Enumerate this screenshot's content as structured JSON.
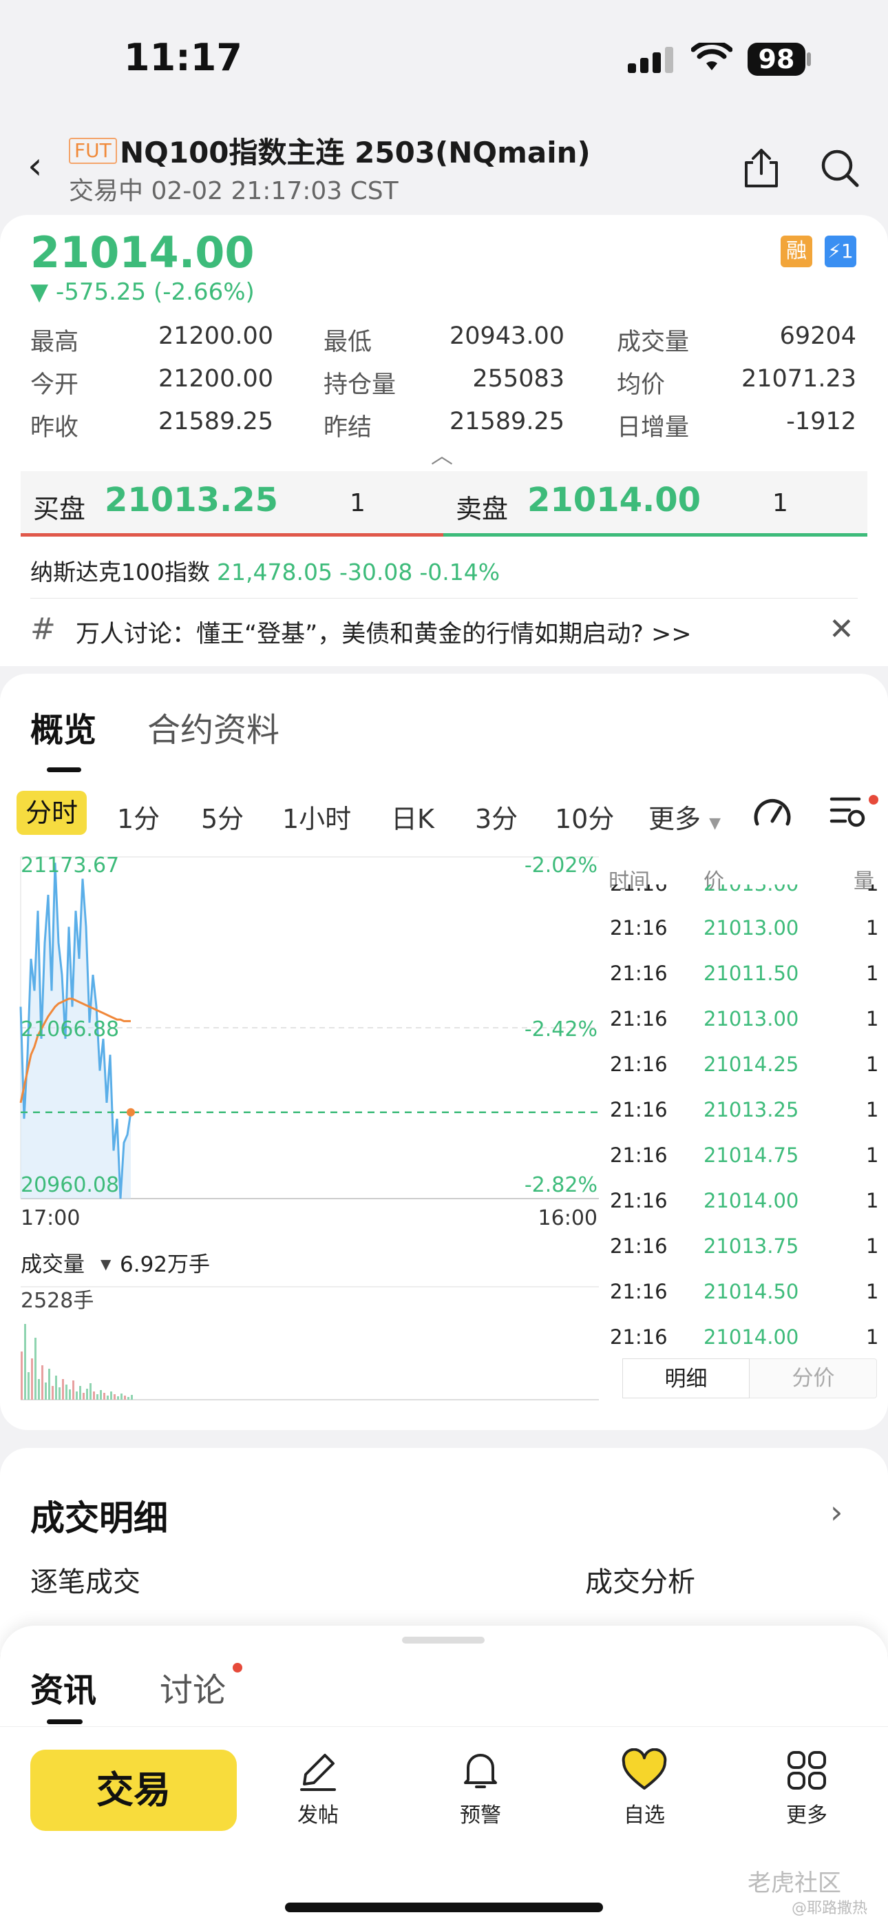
{
  "status_bar": {
    "time": "11:17",
    "battery": "98"
  },
  "header": {
    "badge": "FUT",
    "title": "NQ100指数主连 2503(NQmain)",
    "subtitle": "交易中 02-02 21:17:03 CST"
  },
  "quote": {
    "price": "21014.00",
    "change": "▼ -575.25 (-2.66%)",
    "badge_margin": "融",
    "badge_flash": "⚡1",
    "stats": [
      {
        "label": "最高",
        "value": "21200.00"
      },
      {
        "label": "最低",
        "value": "20943.00"
      },
      {
        "label": "成交量",
        "value": "69204"
      },
      {
        "label": "今开",
        "value": "21200.00"
      },
      {
        "label": "持仓量",
        "value": "255083"
      },
      {
        "label": "均价",
        "value": "21071.23"
      },
      {
        "label": "昨收",
        "value": "21589.25"
      },
      {
        "label": "昨结",
        "value": "21589.25"
      },
      {
        "label": "日增量",
        "value": "-1912"
      }
    ]
  },
  "order_book": {
    "bid_label": "买盘",
    "bid_price": "21013.25",
    "bid_qty": "1",
    "ask_label": "卖盘",
    "ask_price": "21014.00",
    "ask_qty": "1"
  },
  "index_line": {
    "name": "纳斯达克100指数",
    "value": "21,478.05",
    "change": "-30.08",
    "pct": "-0.14%"
  },
  "topic": {
    "text": "万人讨论：懂王“登基”，美债和黄金的行情如期启动? >>"
  },
  "tabs": {
    "overview": "概览",
    "contract": "合约资料"
  },
  "periods": {
    "active": "分时",
    "items": [
      "1分",
      "5分",
      "1小时",
      "日K",
      "3分",
      "10分",
      "更多"
    ]
  },
  "chart": {
    "y_top": "21173.67",
    "y_mid": "21066.88",
    "y_bot": "20960.08",
    "pct_top": "-2.02%",
    "pct_mid": "-2.42%",
    "pct_bot": "-2.82%",
    "x_start": "17:00",
    "x_end": "16:00",
    "volume_label": "成交量",
    "volume_value": "6.92万手",
    "volume_max": "2528手",
    "price_color": "#5aaee8",
    "avg_color": "#f0883a",
    "ref_color": "#3dbb7a"
  },
  "chart_data": {
    "type": "line",
    "ylim": [
      20960.08,
      21173.67
    ],
    "series": [
      {
        "values": [
          21080,
          21010,
          21050,
          21110,
          21090,
          21140,
          21060,
          21120,
          21150,
          21090,
          21170,
          21120,
          21100,
          21060,
          21130,
          21080,
          21140,
          21110,
          21160,
          21130,
          21070,
          21100,
          21080,
          21040,
          21060,
          21020,
          21050,
          20990,
          21010,
          20960,
          20995,
          21000,
          21014
        ]
      },
      {
        "values": [
          21020,
          21030,
          21040,
          21050,
          21055,
          21062,
          21066,
          21070,
          21074,
          21077,
          21080,
          21082,
          21083,
          21084,
          21085,
          21085,
          21084,
          21083,
          21082,
          21081,
          21080,
          21079,
          21078,
          21077,
          21076,
          21075,
          21074,
          21073,
          21072,
          21072,
          21071,
          21071,
          21071
        ]
      }
    ],
    "reference": 21014.0
  },
  "ticks": {
    "headers": [
      "时间",
      "价",
      "量"
    ],
    "partial_top": {
      "time": "21:16",
      "price": "21013.00",
      "qty": "1"
    },
    "rows": [
      {
        "time": "21:16",
        "price": "21013.00",
        "qty": "1"
      },
      {
        "time": "21:16",
        "price": "21011.50",
        "qty": "1"
      },
      {
        "time": "21:16",
        "price": "21013.00",
        "qty": "1"
      },
      {
        "time": "21:16",
        "price": "21014.25",
        "qty": "1"
      },
      {
        "time": "21:16",
        "price": "21013.25",
        "qty": "1"
      },
      {
        "time": "21:16",
        "price": "21014.75",
        "qty": "1"
      },
      {
        "time": "21:16",
        "price": "21014.00",
        "qty": "1"
      },
      {
        "time": "21:16",
        "price": "21013.75",
        "qty": "1"
      },
      {
        "time": "21:16",
        "price": "21014.50",
        "qty": "1"
      }
    ],
    "partial_bottom": {
      "time": "21:16",
      "price": "21014.00",
      "qty": "1"
    },
    "toggle_detail": "明细",
    "toggle_split": "分价"
  },
  "deals": {
    "title": "成交明细",
    "tick_label": "逐笔成交",
    "analysis_label": "成交分析"
  },
  "sheet": {
    "news": "资讯",
    "discuss": "讨论"
  },
  "bottom_nav": {
    "trade": "交易",
    "items": [
      {
        "label": "发帖",
        "icon": "pen-icon"
      },
      {
        "label": "预警",
        "icon": "bell-icon"
      },
      {
        "label": "自选",
        "icon": "heart-icon"
      },
      {
        "label": "更多",
        "icon": "grid-icon"
      }
    ]
  },
  "watermark": {
    "main": "老虎社区",
    "sub": "@耶路撒热"
  }
}
